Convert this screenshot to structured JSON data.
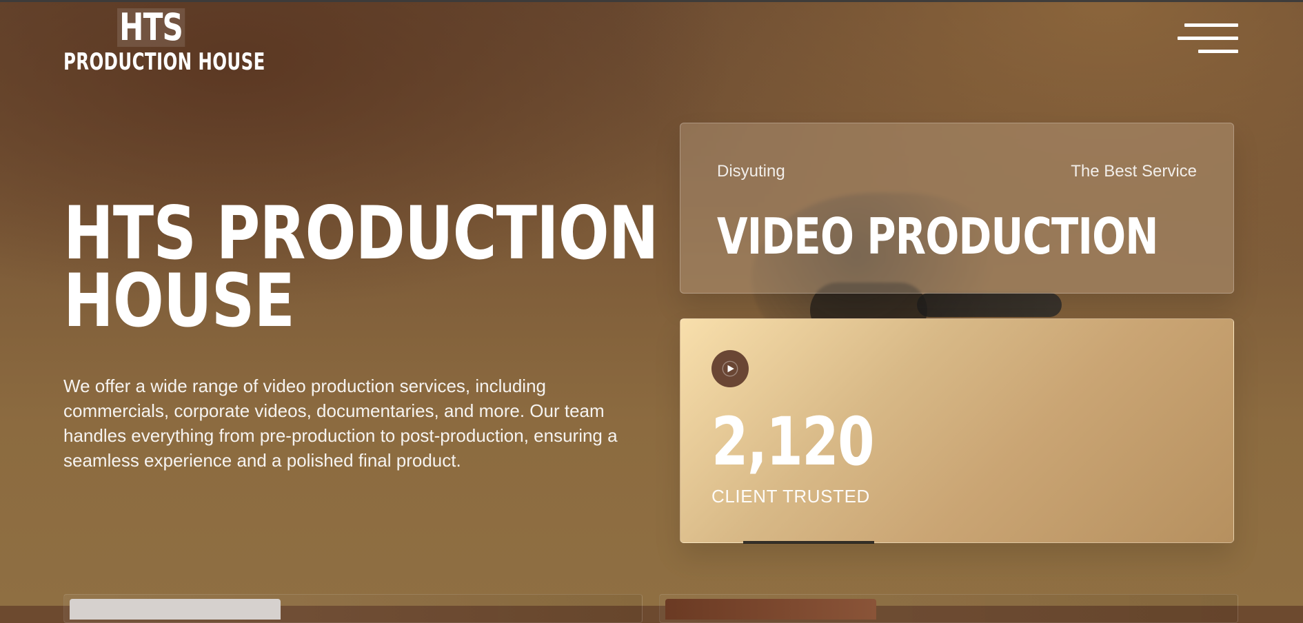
{
  "header": {
    "logo_hts": "HTS",
    "logo_sub": "PRODUCTION HOUSE",
    "menu_icon": "hamburger-menu-icon"
  },
  "hero": {
    "title": "HTS PRODUCTION\nHOUSE",
    "description": "We offer a wide range of video production services, including commercials, corporate videos, documentaries, and more. Our team handles everything from pre-production to post-production, ensuring a seamless experience and a polished final product."
  },
  "cards": {
    "top": {
      "left_label": "Disyuting",
      "right_label": "The Best Service",
      "title": "VIDEO PRODUCTION"
    },
    "bottom": {
      "play_icon": "play-icon",
      "count": "2,120",
      "label": "CLIENT TRUSTED"
    }
  },
  "colors": {
    "background_dark": "#6a4a31",
    "background_light": "#8f6f42",
    "card_gradient_start": "#f8dfac",
    "card_gradient_end": "#b6905f",
    "play_circle": "#6a4634"
  }
}
